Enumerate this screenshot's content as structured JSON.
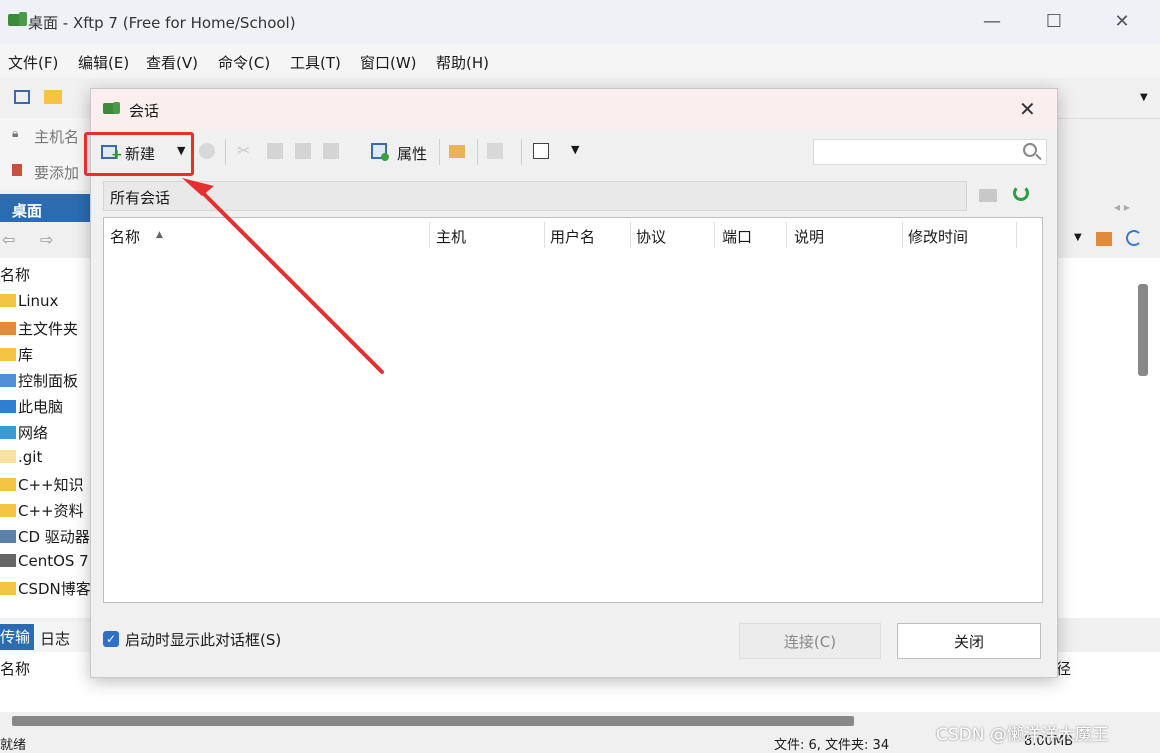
{
  "window": {
    "title": "桌面 - Xftp 7 (Free for Home/School)",
    "minimize": "—",
    "maximize": "☐",
    "close": "✕"
  },
  "menu": [
    "文件(F)",
    "编辑(E)",
    "查看(V)",
    "命令(C)",
    "工具(T)",
    "窗口(W)",
    "帮助(H)"
  ],
  "address": {
    "label": "主机名"
  },
  "addbar": {
    "label": "要添加"
  },
  "left_tab": {
    "label": "桌面"
  },
  "file_list": {
    "header": "名称",
    "items": [
      "Linux",
      "主文件夹",
      "库",
      "控制面板",
      "此电脑",
      "网络",
      ".git",
      "C++知识",
      "C++资料",
      "CD 驱动器",
      "CentOS 7",
      "CSDN博客"
    ]
  },
  "bottom": {
    "tab_transfer": "传输",
    "tab_log": "日志",
    "header_name": "名称",
    "header_right": "径"
  },
  "status": {
    "left": "就绪",
    "files": "文件: 6, 文件夹: 34",
    "size": "8.00MB"
  },
  "dialog": {
    "title": "会话",
    "close": "✕",
    "toolbar": {
      "new_label": "新建",
      "properties_label": "属性"
    },
    "search": {
      "placeholder": ""
    },
    "path": "所有会话",
    "columns": [
      "名称",
      "主机",
      "用户名",
      "协议",
      "端口",
      "说明",
      "修改时间"
    ],
    "startup_checkbox": "启动时显示此对话框(S)",
    "connect_label": "连接(C)",
    "close_label": "关闭"
  },
  "colors": {
    "accent": "#2b6cb0",
    "annotation": "#e53030"
  },
  "watermark": "CSDN @懒洋洋大魔王"
}
